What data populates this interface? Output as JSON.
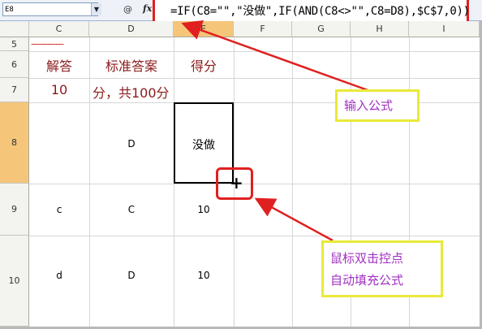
{
  "formula_bar": {
    "name_box": "E8",
    "dropdown_glyph": "▼",
    "icons": [
      "zoom-icon",
      "fx-icon"
    ],
    "zoom_glyph": "@",
    "fx_label": "fx",
    "formula": "=IF(C8=\"\",\"没做\",IF(AND(C8<>\"\",C8=D8),$C$7,0))"
  },
  "columns": [
    "C",
    "D",
    "E",
    "F",
    "G",
    "H",
    "I"
  ],
  "rows": [
    "5",
    "6",
    "7",
    "8",
    "9",
    "10"
  ],
  "cells": {
    "c5_dashes": "------------",
    "c6": "解答",
    "d6": "标准答案",
    "e6": "得分",
    "c7": "10",
    "d7": "分，共100分",
    "d8": "D",
    "e8": "没做",
    "c9": "c",
    "d9": "C",
    "e9": "10",
    "c10": "d",
    "d10": "D",
    "e10": "10"
  },
  "fill_handle_glyph": "+",
  "callouts": {
    "formula": "输入公式",
    "fill_line1": "鼠标双击控点",
    "fill_line2": "自动填充公式"
  },
  "colors": {
    "annotation_red": "#e02020",
    "callout_border": "#e9e93a",
    "callout_text": "#a030c0",
    "cell_text_red": "#8b1a1a",
    "selected_header": "#f5c679"
  }
}
